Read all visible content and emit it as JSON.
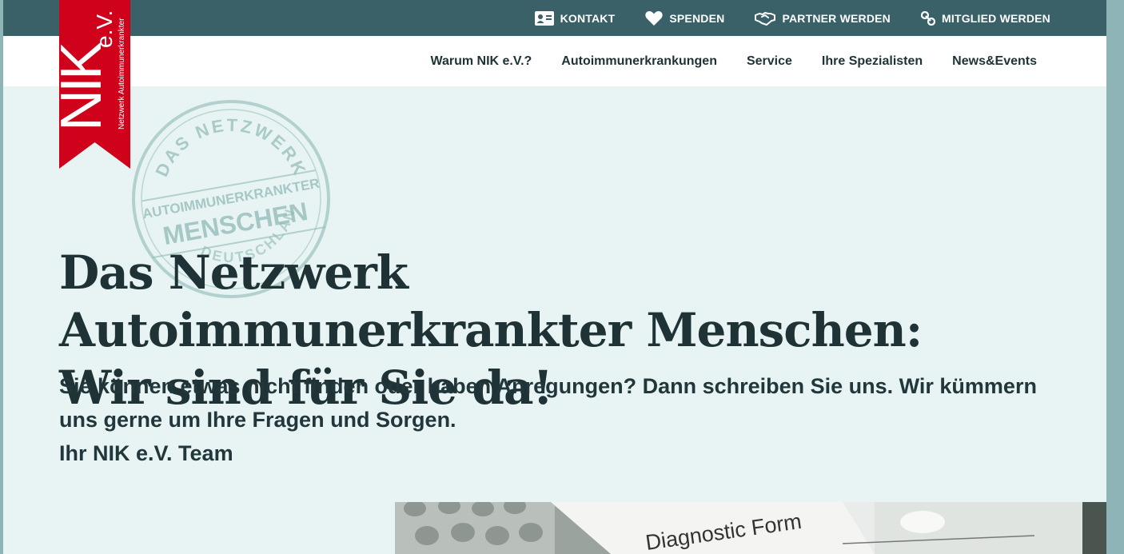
{
  "topbar": {
    "items": [
      {
        "label": "KONTAKT",
        "icon": "contact-card-icon"
      },
      {
        "label": "SPENDEN",
        "icon": "heart-icon"
      },
      {
        "label": "PARTNER WERDEN",
        "icon": "handshake-icon"
      },
      {
        "label": "MITGLIED WERDEN",
        "icon": "link-icon"
      }
    ]
  },
  "nav": {
    "items": [
      "Warum NIK e.V.?",
      "Autoimmunerkrankungen",
      "Service",
      "Ihre Spezialisten",
      "News&Events"
    ]
  },
  "logo": {
    "text": "NIK",
    "suffix": "e.V.",
    "tagline": "Netzwerk Autoimmunerkrankter"
  },
  "stamp": {
    "top_arc": "DAS NETZWERK",
    "line1": "AUTOIMMUNERKRANKTER",
    "line2": "MENSCHEN",
    "bottom_arc": "DEUTSCHLAND"
  },
  "hero": {
    "title": "Das Netzwerk Autoimmunerkrankter Menschen: Wir sind für Sie da!",
    "subtitle_line1": "Sie können etwas nicht finden oder haben Anregungen? Dann schreiben Sie uns. Wir kümmern uns gerne um Ihre Fragen und Sorgen.",
    "subtitle_line2": "Ihr NIK e.V. Team"
  },
  "image": {
    "caption_text": "Diagnostic Form"
  },
  "colors": {
    "topbar": "#3a6167",
    "logo_red": "#d0021b",
    "page_bg": "#e7f4f3",
    "stamp": "#8fb9b6"
  }
}
